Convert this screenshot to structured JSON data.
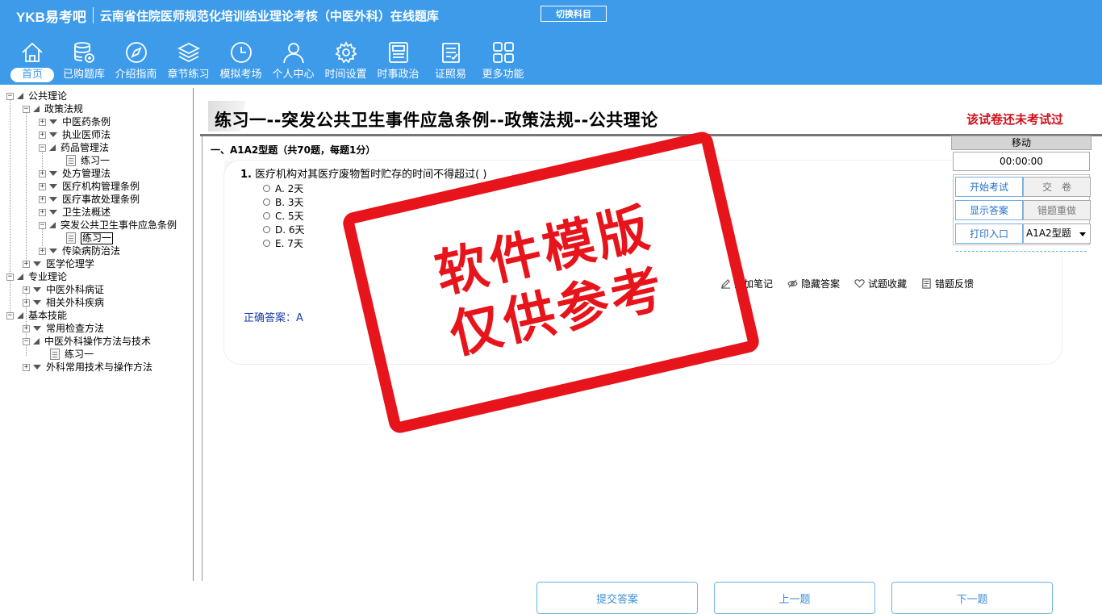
{
  "brand": {
    "logo": "YKB易考吧",
    "title": "云南省住院医师规范化培训结业理论考核（中医外科）在线题库",
    "switch_label": "切换科目"
  },
  "nav": [
    {
      "label": "首页",
      "icon": "home-icon"
    },
    {
      "label": "已购题库",
      "icon": "database-icon"
    },
    {
      "label": "介绍指南",
      "icon": "compass-icon"
    },
    {
      "label": "章节练习",
      "icon": "layers-icon"
    },
    {
      "label": "模拟考场",
      "icon": "clock-icon"
    },
    {
      "label": "个人中心",
      "icon": "user-icon"
    },
    {
      "label": "时间设置",
      "icon": "gear-icon"
    },
    {
      "label": "时事政治",
      "icon": "news-icon"
    },
    {
      "label": "证照易",
      "icon": "clipboard-icon"
    },
    {
      "label": "更多功能",
      "icon": "grid-icon"
    }
  ],
  "tree": [
    {
      "label": "公共理论"
    },
    {
      "label": "政策法规"
    },
    {
      "label": "中医药条例"
    },
    {
      "label": "执业医师法"
    },
    {
      "label": "药品管理法"
    },
    {
      "label": "练习一"
    },
    {
      "label": "处方管理法"
    },
    {
      "label": "医疗机构管理条例"
    },
    {
      "label": "医疗事故处理条例"
    },
    {
      "label": "卫生法概述"
    },
    {
      "label": "突发公共卫生事件应急条例"
    },
    {
      "label": "练习一"
    },
    {
      "label": "传染病防治法"
    },
    {
      "label": "医学伦理学"
    },
    {
      "label": "专业理论"
    },
    {
      "label": "中医外科病证"
    },
    {
      "label": "相关外科疾病"
    },
    {
      "label": "基本技能"
    },
    {
      "label": "常用检查方法"
    },
    {
      "label": "中医外科操作方法与技术"
    },
    {
      "label": "练习一"
    },
    {
      "label": "外科常用技术与操作方法"
    }
  ],
  "paper": {
    "title": "练习一--突发公共卫生事件应急条例--政策法规--公共理论",
    "status": "该试卷还未考试过"
  },
  "section": {
    "title": "一、A1A2型题（共70题，每题1分）"
  },
  "question": {
    "number": "1.",
    "text": "医疗机构对其医疗废物暂时贮存的时间不得超过(   )",
    "options": [
      "A. 2天",
      "B. 3天",
      "C. 5天",
      "D. 6天",
      "E. 7天"
    ],
    "answer_label": "正确答案：A"
  },
  "tools": {
    "note": "添加笔记",
    "hide_answer": "隐藏答案",
    "favorite": "试题收藏",
    "feedback": "错题反馈"
  },
  "buttons": {
    "submit": "提交答案",
    "prev": "上一题",
    "next": "下一题"
  },
  "control": {
    "move": "移动",
    "timer": "00:00:00",
    "start": "开始考试",
    "hand_in": "交　卷",
    "show_answer": "显示答案",
    "redo_wrong": "错题重做",
    "print": "打印入口",
    "type_select": "A1A2型题"
  },
  "watermark": {
    "line1": "软件模版",
    "line2": "仅供参考",
    "color": "#e8141b"
  },
  "colors": {
    "header": "#3d9be9",
    "status": "#d0121b",
    "answer": "#1a3ea8"
  }
}
